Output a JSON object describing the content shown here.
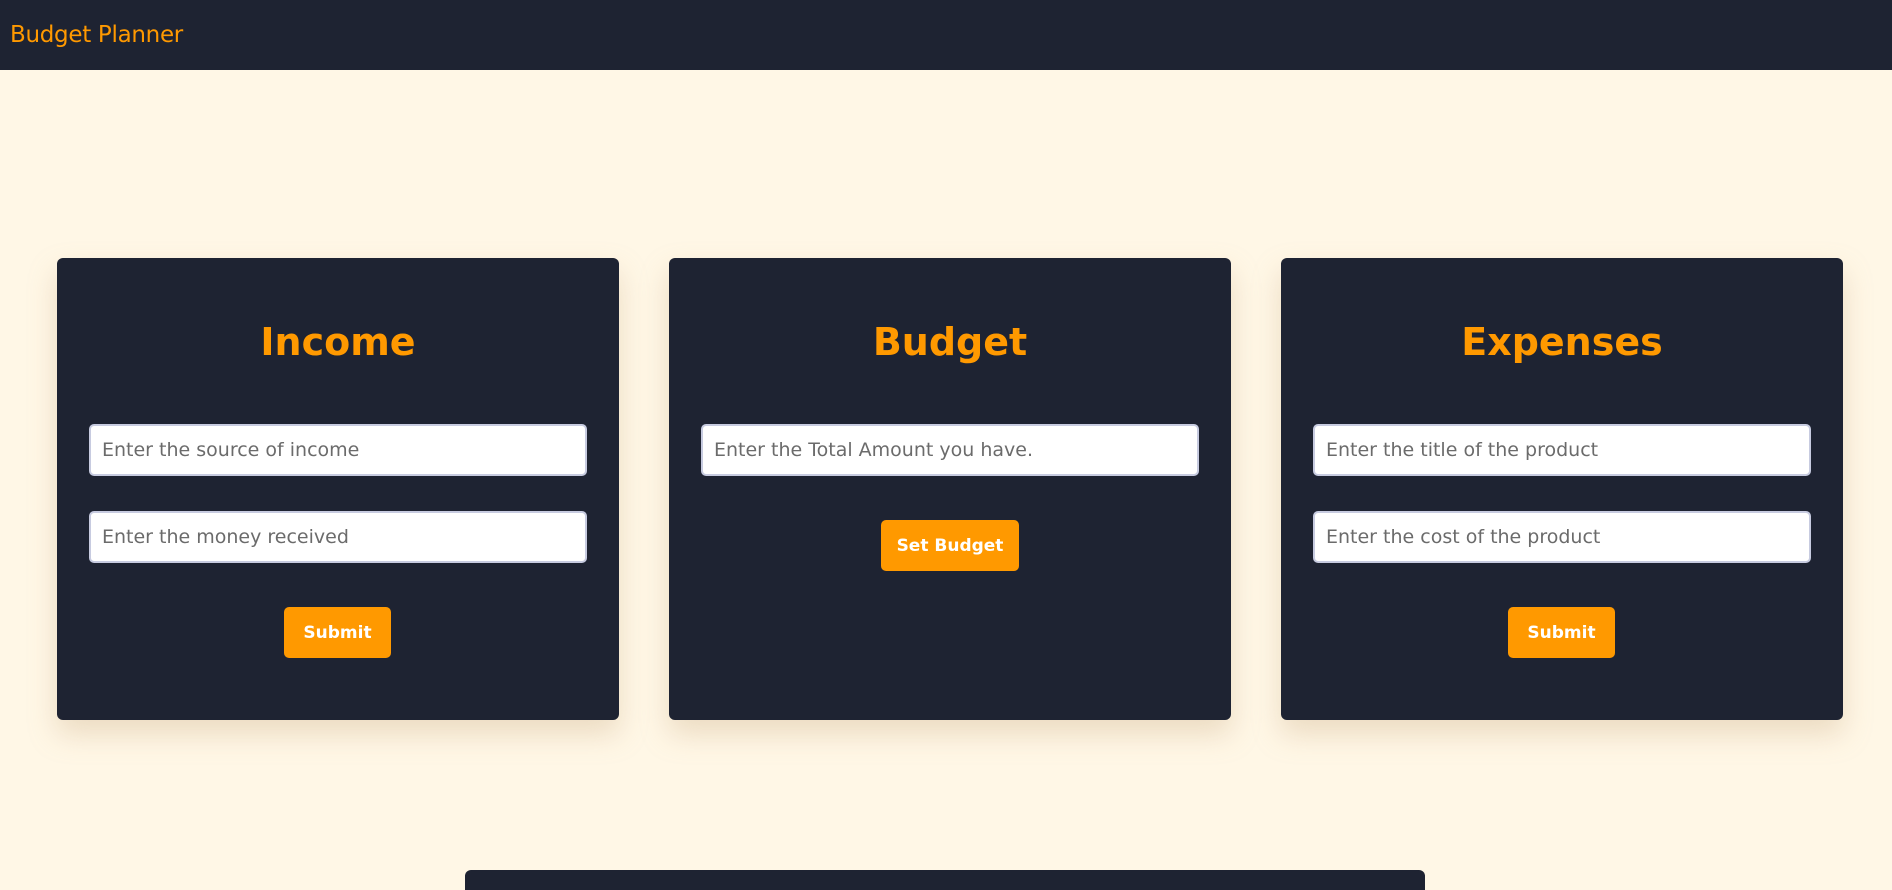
{
  "navbar": {
    "brand": "Budget Planner"
  },
  "income": {
    "title": "Income",
    "source_placeholder": "Enter the source of income",
    "money_placeholder": "Enter the money received",
    "submit_label": "Submit"
  },
  "budget": {
    "title": "Budget",
    "amount_placeholder": "Enter the Total Amount you have.",
    "set_label": "Set Budget"
  },
  "expenses": {
    "title": "Expenses",
    "title_placeholder": "Enter the title of the product",
    "cost_placeholder": "Enter the cost of the product",
    "submit_label": "Submit"
  },
  "colors": {
    "background": "#fff7e6",
    "panel": "#1e2332",
    "accent": "#ff9900"
  }
}
